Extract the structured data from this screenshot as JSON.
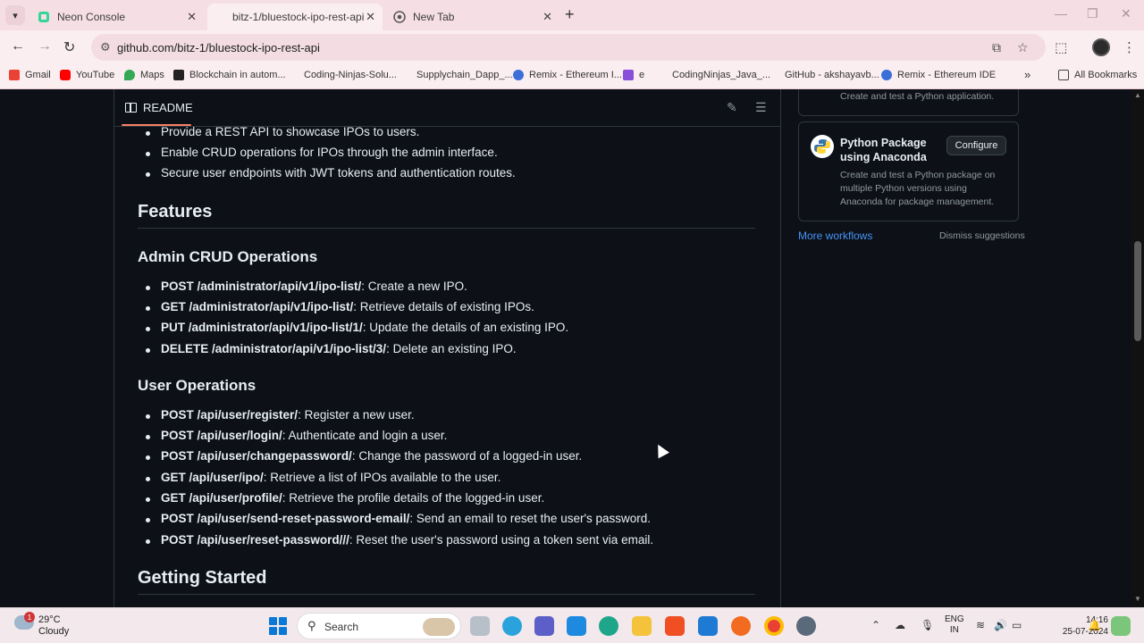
{
  "browser": {
    "tabs": [
      {
        "title": "Neon Console",
        "active": false
      },
      {
        "title": "bitz-1/bluestock-ipo-rest-api",
        "active": true
      },
      {
        "title": "New Tab",
        "active": false
      }
    ],
    "url": "github.com/bitz-1/bluestock-ipo-rest-api",
    "bookmarks": [
      "Gmail",
      "YouTube",
      "Maps",
      "Blockchain in autom...",
      "Coding-Ninjas-Solu...",
      "Supplychain_Dapp_...",
      "Remix - Ethereum I...",
      "e",
      "CodingNinjas_Java_...",
      "GitHub - akshayavb...",
      "Remix - Ethereum IDE"
    ],
    "all_bookmarks": "All Bookmarks"
  },
  "readme": {
    "tab_label": "README",
    "intro_items": [
      "Provide a REST API to showcase IPOs to users.",
      "Enable CRUD operations for IPOs through the admin interface.",
      "Secure user endpoints with JWT tokens and authentication routes."
    ],
    "features_heading": "Features",
    "admin_heading": "Admin CRUD Operations",
    "admin_items": [
      {
        "endpoint": "POST /administrator/api/v1/ipo-list/",
        "desc": ": Create a new IPO."
      },
      {
        "endpoint": "GET /administrator/api/v1/ipo-list/",
        "desc": ": Retrieve details of existing IPOs."
      },
      {
        "endpoint": "PUT /administrator/api/v1/ipo-list/1/",
        "desc": ": Update the details of an existing IPO."
      },
      {
        "endpoint": "DELETE /administrator/api/v1/ipo-list/3/",
        "desc": ": Delete an existing IPO."
      }
    ],
    "user_heading": "User Operations",
    "user_items": [
      {
        "endpoint": "POST /api/user/register/",
        "desc": ": Register a new user."
      },
      {
        "endpoint": "POST /api/user/login/",
        "desc": ": Authenticate and login a user."
      },
      {
        "endpoint": "POST /api/user/changepassword/",
        "desc": ": Change the password of a logged-in user."
      },
      {
        "endpoint": "GET /api/user/ipo/",
        "desc": ": Retrieve a list of IPOs available to the user."
      },
      {
        "endpoint": "GET /api/user/profile/",
        "desc": ": Retrieve the profile details of the logged-in user."
      },
      {
        "endpoint": "POST /api/user/send-reset-password-email/",
        "desc": ": Send an email to reset the user's password."
      },
      {
        "endpoint": "POST /api/user/reset-password///",
        "desc": ": Reset the user's password using a token sent via email."
      }
    ],
    "getting_started_heading": "Getting Started"
  },
  "sidebar": {
    "card1_desc": "Create and test a Python application.",
    "card2_title": "Python Package using Anaconda",
    "card2_desc": "Create and test a Python package on multiple Python versions using Anaconda for package management.",
    "configure_label": "Configure",
    "more_workflows": "More workflows",
    "dismiss": "Dismiss suggestions"
  },
  "taskbar": {
    "weather_badge": "1",
    "temperature": "29°C",
    "condition": "Cloudy",
    "search_label": "Search",
    "lang_line1": "ENG",
    "lang_line2": "IN",
    "time": "14:16",
    "date": "25-07-2024"
  },
  "colors": {
    "page_bg": "#0d1117",
    "text": "#e6edf3",
    "muted": "#9198a1",
    "link": "#4493f8",
    "tab_strip": "#f6dfe4",
    "readme_underline": "#f78166"
  }
}
